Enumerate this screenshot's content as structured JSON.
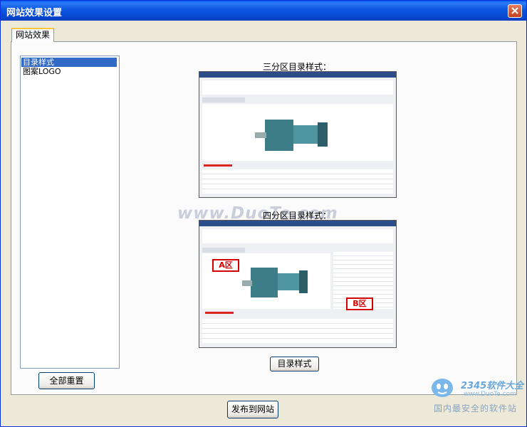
{
  "window": {
    "title": "网站效果设置"
  },
  "tab": {
    "label": "网站效果"
  },
  "list": {
    "items": [
      "目录样式",
      "图案LOGO"
    ]
  },
  "buttons": {
    "reset_all": "全部重置",
    "catalog_style": "目录样式",
    "publish": "发布到网站"
  },
  "previews": {
    "three_zone_caption": "三分区目录样式：",
    "four_zone_caption": "四分区目录样式：",
    "zone_a": "A区",
    "zone_b": "B区"
  },
  "watermark": {
    "text": "www.DuoTe.com"
  },
  "logo": {
    "brand": "2345软件大全",
    "url": "www.DuoTe.com",
    "slogan": "国内最安全的软件站"
  }
}
